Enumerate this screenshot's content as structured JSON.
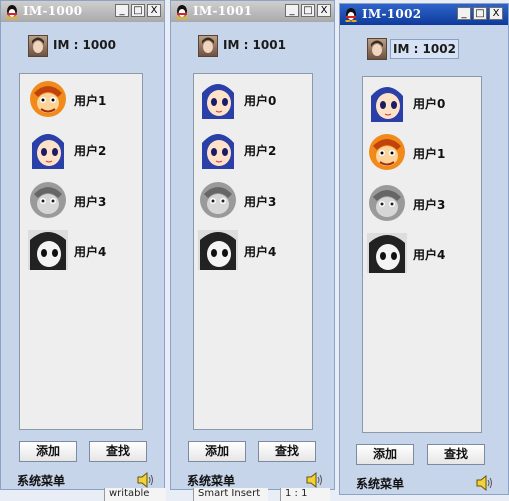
{
  "windows": [
    {
      "title": "IM-1000",
      "me_label": "IM : 1000",
      "users": [
        {
          "name": "用户1",
          "avatar": "monkey-face-icon"
        },
        {
          "name": "用户2",
          "avatar": "blue-hair-girl-icon"
        },
        {
          "name": "用户3",
          "avatar": "monkey-face-gray-icon"
        },
        {
          "name": "用户4",
          "avatar": "girl-gray-icon"
        }
      ],
      "add_label": "添加",
      "find_label": "查找",
      "menu_label": "系统菜单"
    },
    {
      "title": "IM-1001",
      "me_label": "IM : 1001",
      "users": [
        {
          "name": "用户0",
          "avatar": "blue-hair-girl-icon"
        },
        {
          "name": "用户2",
          "avatar": "blue-hair-girl-icon"
        },
        {
          "name": "用户3",
          "avatar": "monkey-face-gray-icon"
        },
        {
          "name": "用户4",
          "avatar": "girl-gray-icon"
        }
      ],
      "add_label": "添加",
      "find_label": "查找",
      "menu_label": "系统菜单"
    },
    {
      "title": "IM-1002",
      "me_label": "IM : 1002",
      "users": [
        {
          "name": "用户0",
          "avatar": "blue-hair-girl-icon"
        },
        {
          "name": "用户1",
          "avatar": "monkey-face-icon"
        },
        {
          "name": "用户3",
          "avatar": "monkey-face-gray-icon"
        },
        {
          "name": "用户4",
          "avatar": "girl-gray-icon"
        }
      ],
      "add_label": "添加",
      "find_label": "查找",
      "menu_label": "系统菜单"
    }
  ],
  "titlebar_buttons": {
    "minimize": "_",
    "maximize": "□",
    "close": "X"
  },
  "taskbar": [
    "writable",
    "Smart Insert",
    "1 : 1"
  ],
  "colors": {
    "active_title": "#0f3a9c",
    "inactive_title": "#a9a9a9",
    "window_bg": "#c7d5ea"
  }
}
